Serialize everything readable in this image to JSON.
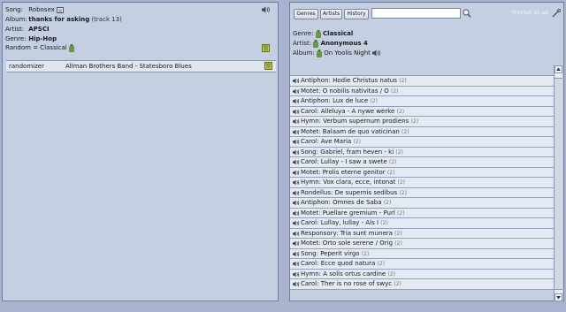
{
  "now_playing": {
    "song_label": "Song:",
    "song": "Robosex",
    "album_label": "Album:",
    "album": "thanks for asking",
    "album_note": "(track 13)",
    "artist_label": "Artist:",
    "artist": "APSCI",
    "genre_label": "Genre:",
    "genre": "Hip-Hop",
    "random_label": "Random = Classical"
  },
  "queue": {
    "rows": [
      {
        "source": "randomizer",
        "track": "Allman Brothers Band - Statesboro Blues"
      }
    ]
  },
  "browser": {
    "tabs": [
      "Genres",
      "Artists",
      "History"
    ],
    "search_placeholder": "",
    "version": "Freshet v2.a6",
    "genre_label": "Genre:",
    "genre": "Classical",
    "artist_label": "Artist:",
    "artist": "Anonymous 4",
    "album_label": "Album:",
    "album": "On Yoolis Night",
    "tracks": [
      {
        "title": "Antiphon: Hodie Christus natus",
        "count": "(2)"
      },
      {
        "title": "Motet: O nobilis nativitas / O",
        "count": "(2)"
      },
      {
        "title": "Antiphon: Lux de luce",
        "count": "(2)"
      },
      {
        "title": "Carol: Alleluya - A nywe werke",
        "count": "(2)"
      },
      {
        "title": "Hymn: Verbum supernum prodiens",
        "count": "(2)"
      },
      {
        "title": "Motet: Balaam de quo vaticinan",
        "count": "(2)"
      },
      {
        "title": "Carol: Ave Maria",
        "count": "(2)"
      },
      {
        "title": "Song: Gabriel, fram heven - ki",
        "count": "(2)"
      },
      {
        "title": "Carol: Lullay - I saw a swete",
        "count": "(2)"
      },
      {
        "title": "Motet: Prolis eterne genitor",
        "count": "(2)"
      },
      {
        "title": "Hymn: Vox clara, ecce, intonat",
        "count": "(2)"
      },
      {
        "title": "Rondellus: De supernis sedibus",
        "count": "(2)"
      },
      {
        "title": "Antiphon: Omnes de Saba",
        "count": "(2)"
      },
      {
        "title": "Motet: Puellare gremium - Purl",
        "count": "(2)"
      },
      {
        "title": "Carol: Lullay, lullay - Als I",
        "count": "(2)"
      },
      {
        "title": "Responsory: Tria sunt munera",
        "count": "(2)"
      },
      {
        "title": "Motet: Orto sole serene / Orig",
        "count": "(2)"
      },
      {
        "title": "Song: Peperit virgo",
        "count": "(2)"
      },
      {
        "title": "Carol: Ecce quod natura",
        "count": "(2)"
      },
      {
        "title": "Hymn: A solis ortus cardine",
        "count": "(2)"
      },
      {
        "title": "Carol: Ther is no rose of swyc",
        "count": "(2)"
      }
    ]
  },
  "colors": {
    "background": "#a9b3cf",
    "panel": "#c4d0e1",
    "row": "#e4eaf3"
  }
}
